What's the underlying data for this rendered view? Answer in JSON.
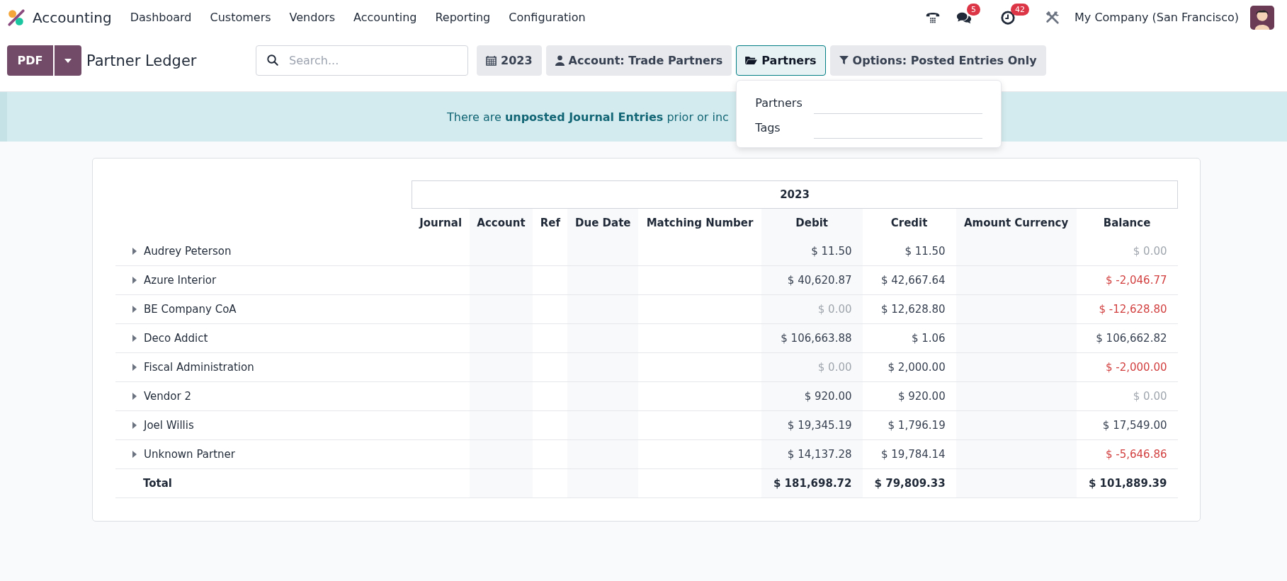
{
  "app": {
    "name": "Accounting"
  },
  "menu": [
    "Dashboard",
    "Customers",
    "Vendors",
    "Accounting",
    "Reporting",
    "Configuration"
  ],
  "systray": {
    "messages_count": "5",
    "activities_count": "42",
    "company": "My Company (San Francisco)"
  },
  "control_panel": {
    "print_button": "PDF",
    "title": "Partner Ledger",
    "search": {
      "placeholder": "Search..."
    },
    "filters": [
      {
        "kind": "date",
        "label": "2023",
        "selected": false
      },
      {
        "kind": "account",
        "label": "Account: Trade Partners",
        "selected": false
      },
      {
        "kind": "partners",
        "label": "Partners",
        "selected": true,
        "dropdown": [
          {
            "label": "Partners"
          },
          {
            "label": "Tags"
          }
        ]
      },
      {
        "kind": "options",
        "label": "Options: Posted Entries Only",
        "selected": false
      }
    ]
  },
  "notice": "There are **unposted Journal Entries** prior or inc",
  "report": {
    "column_group": "2023",
    "columns": [
      "Journal",
      "Account",
      "Ref",
      "Due Date",
      "Matching Number",
      "Debit",
      "Credit",
      "Amount Currency",
      "Balance"
    ],
    "rows": [
      {
        "name": "Audrey Peterson",
        "expanded": false,
        "debit": {
          "text": "$ 11.50",
          "color": "#374151"
        },
        "credit": {
          "text": "$ 11.50",
          "color": "#374151"
        },
        "balance": {
          "text": "$ 0.00",
          "color": "#a0a6ae"
        }
      },
      {
        "name": "Azure Interior",
        "expanded": false,
        "debit": {
          "text": "$ 40,620.87",
          "color": "#374151"
        },
        "credit": {
          "text": "$ 42,667.64",
          "color": "#374151"
        },
        "balance": {
          "text": "$ -2,046.77",
          "color": "#d23f3f"
        }
      },
      {
        "name": "BE Company CoA",
        "expanded": false,
        "debit": {
          "text": "$ 0.00",
          "color": "#a0a6ae"
        },
        "credit": {
          "text": "$ 12,628.80",
          "color": "#374151"
        },
        "balance": {
          "text": "$ -12,628.80",
          "color": "#d23f3f"
        }
      },
      {
        "name": "Deco Addict",
        "expanded": false,
        "debit": {
          "text": "$ 106,663.88",
          "color": "#374151"
        },
        "credit": {
          "text": "$ 1.06",
          "color": "#374151"
        },
        "balance": {
          "text": "$ 106,662.82",
          "color": "#374151"
        }
      },
      {
        "name": "Fiscal Administration",
        "expanded": false,
        "debit": {
          "text": "$ 0.00",
          "color": "#a0a6ae"
        },
        "credit": {
          "text": "$ 2,000.00",
          "color": "#374151"
        },
        "balance": {
          "text": "$ -2,000.00",
          "color": "#d23f3f"
        }
      },
      {
        "name": "Vendor 2",
        "expanded": false,
        "debit": {
          "text": "$ 920.00",
          "color": "#374151"
        },
        "credit": {
          "text": "$ 920.00",
          "color": "#374151"
        },
        "balance": {
          "text": "$ 0.00",
          "color": "#a0a6ae"
        }
      },
      {
        "name": "Joel Willis",
        "expanded": false,
        "debit": {
          "text": "$ 19,345.19",
          "color": "#374151"
        },
        "credit": {
          "text": "$ 1,796.19",
          "color": "#374151"
        },
        "balance": {
          "text": "$ 17,549.00",
          "color": "#374151"
        }
      },
      {
        "name": "Unknown Partner",
        "expanded": false,
        "debit": {
          "text": "$ 14,137.28",
          "color": "#374151"
        },
        "credit": {
          "text": "$ 19,784.14",
          "color": "#374151"
        },
        "balance": {
          "text": "$ -5,646.86",
          "color": "#d23f3f"
        }
      }
    ],
    "total": {
      "name": "Total",
      "debit": {
        "text": "$ 181,698.72"
      },
      "credit": {
        "text": "$ 79,809.33"
      },
      "balance": {
        "text": "$ 101,889.39"
      }
    }
  }
}
